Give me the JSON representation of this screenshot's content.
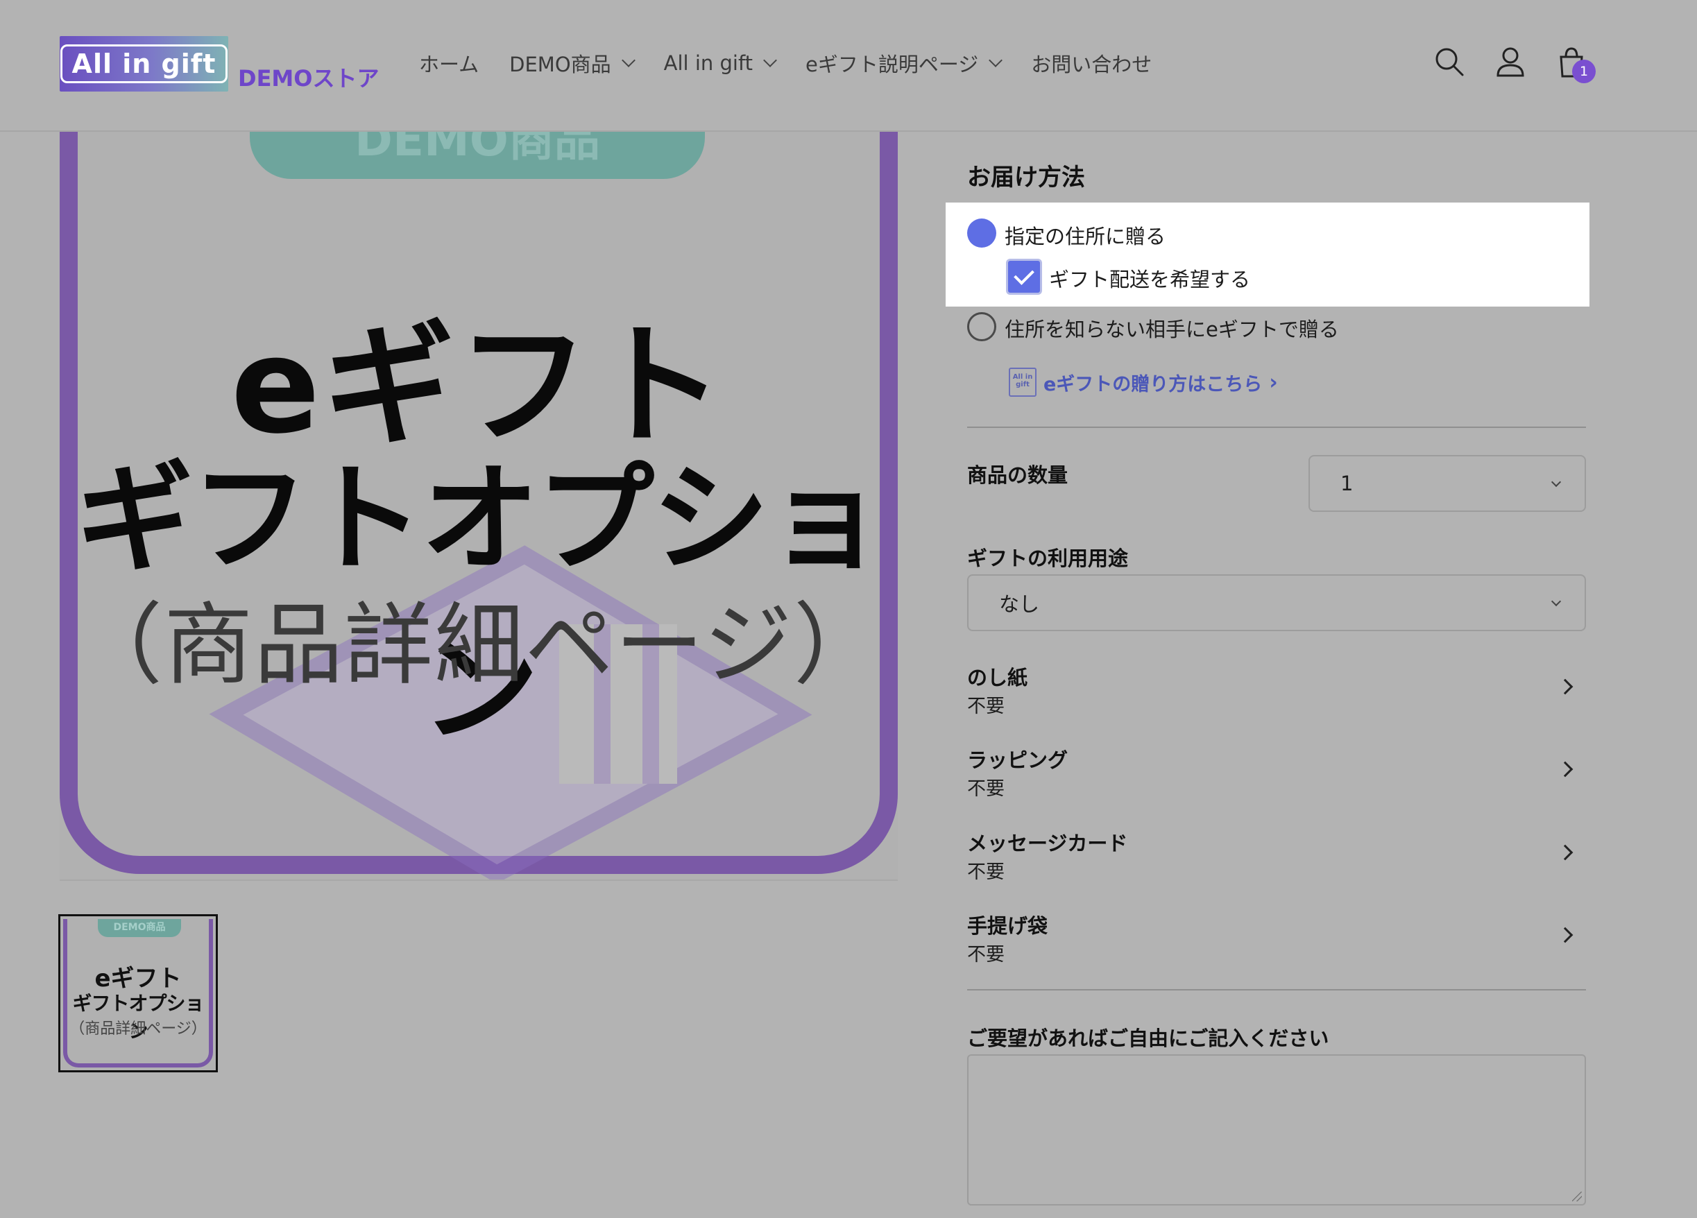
{
  "header": {
    "logo_text": "All in gift",
    "store_name": "DEMOストア",
    "nav": [
      {
        "label": "ホーム",
        "has_dropdown": false
      },
      {
        "label": "DEMO商品",
        "has_dropdown": true
      },
      {
        "label": "All in gift",
        "has_dropdown": true
      },
      {
        "label": "eギフト説明ページ",
        "has_dropdown": true
      },
      {
        "label": "お問い合わせ",
        "has_dropdown": false
      }
    ],
    "icons": [
      "search-icon",
      "account-icon",
      "cart-icon"
    ],
    "cart_count": "1"
  },
  "product_image": {
    "pill": "DEMO商品",
    "line1": "eギフト",
    "line2": "ギフトオプション",
    "line3": "（商品詳細ページ）"
  },
  "thumbnail": {
    "pill": "DEMO商品",
    "line1": "eギフト",
    "line2": "ギフトオプション",
    "line3": "（商品詳細ページ）"
  },
  "delivery": {
    "title": "お届け方法",
    "option_address": "指定の住所に贈る",
    "gift_shipping_checkbox": "ギフト配送を希望する",
    "option_egift": "住所を知らない相手にeギフトで贈る",
    "egift_link": "eギフトの贈り方はこちら",
    "egift_link_icon_text": "All in gift"
  },
  "quantity": {
    "label": "商品の数量",
    "value": "1"
  },
  "usage": {
    "label": "ギフトの利用用途",
    "value": "なし"
  },
  "options": [
    {
      "name": "のし紙",
      "value": "不要"
    },
    {
      "name": "ラッピング",
      "value": "不要"
    },
    {
      "name": "メッセージカード",
      "value": "不要"
    },
    {
      "name": "手提げ袋",
      "value": "不要"
    }
  ],
  "request": {
    "label": "ご要望があればご自由にご記入ください"
  },
  "colors": {
    "accent": "#5e6ee4",
    "brand_purple": "#7a59a6",
    "pill_teal": "#6ea59d",
    "overlay_gray": "#b3b3b3"
  }
}
